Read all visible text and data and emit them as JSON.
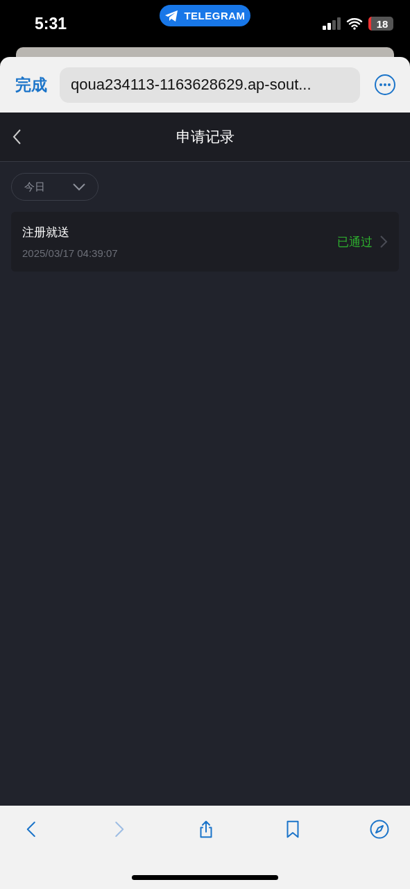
{
  "status_bar": {
    "time": "5:31",
    "app_pill": "TELEGRAM",
    "battery": "18"
  },
  "browser": {
    "done": "完成",
    "url": "qoua234113-1163628629.ap-sout..."
  },
  "nav": {
    "title": "申请记录"
  },
  "filter": {
    "value": "今日"
  },
  "records": [
    {
      "title": "注册就送",
      "time": "2025/03/17 04:39:07",
      "status": "已通过",
      "color": "#2fb52f"
    }
  ],
  "toolbar": [
    {
      "kind": "back",
      "disabled": false
    },
    {
      "kind": "forward",
      "disabled": true
    },
    {
      "kind": "share",
      "disabled": false
    },
    {
      "kind": "bookmarks",
      "disabled": false
    },
    {
      "kind": "compass",
      "disabled": false
    }
  ]
}
